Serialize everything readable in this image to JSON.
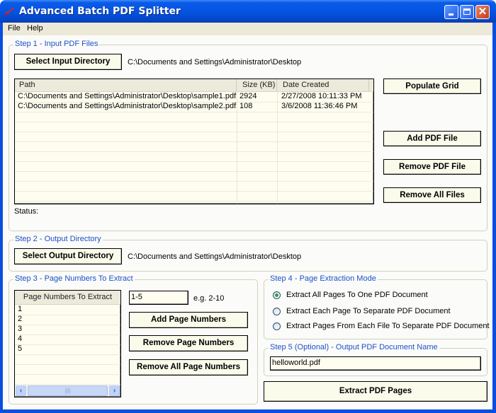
{
  "window": {
    "title": "Advanced Batch PDF Splitter",
    "icon": "scissors-pdf-icon",
    "controls": {
      "minimize": "minimize-icon",
      "maximize": "maximize-icon",
      "close": "close-icon",
      "close_glyph": "✕"
    }
  },
  "menu": {
    "items": [
      "File",
      "Help"
    ]
  },
  "step1": {
    "title": "Step 1 - Input PDF Files",
    "select_button": "Select Input Directory",
    "input_directory": "C:\\Documents and Settings\\Administrator\\Desktop",
    "grid": {
      "columns": [
        "Path",
        "Size (KB)",
        "Date Created"
      ],
      "rows": [
        [
          "C:\\Documents and Settings\\Administrator\\Desktop\\sample1.pdf",
          "2924",
          "2/27/2008 10:11:33 PM"
        ],
        [
          "C:\\Documents and Settings\\Administrator\\Desktop\\sample2.pdf",
          "108",
          "3/6/2008 11:36:46 PM"
        ]
      ]
    },
    "status_label": "Status:",
    "buttons": {
      "populate": "Populate Grid",
      "add": "Add PDF File",
      "remove": "Remove PDF File",
      "remove_all": "Remove All Files"
    }
  },
  "step2": {
    "title": "Step 2 - Output Directory",
    "select_button": "Select Output Directory",
    "output_directory": "C:\\Documents and Settings\\Administrator\\Desktop"
  },
  "step3": {
    "title": "Step 3 - Page Numbers To Extract",
    "list_header": "Page Numbers To Extract",
    "pages": [
      "1",
      "2",
      "3",
      "4",
      "5"
    ],
    "range_input": "1-5",
    "hint": "e.g. 2-10",
    "buttons": {
      "add": "Add Page Numbers",
      "remove": "Remove Page Numbers",
      "remove_all": "Remove All Page Numbers"
    },
    "scroll": {
      "left": "‹",
      "right": "›",
      "grip": "||||"
    }
  },
  "step4": {
    "title": "Step 4 - Page Extraction Mode",
    "options": [
      {
        "label": "Extract All Pages To One PDF Document",
        "selected": true
      },
      {
        "label": "Extract Each Page To Separate PDF Document",
        "selected": false
      },
      {
        "label": "Extract Pages From Each File To Separate PDF Document",
        "selected": false
      }
    ]
  },
  "step5": {
    "title": "Step 5 (Optional) - Output PDF Document Name",
    "filename": "helloworld.pdf"
  },
  "extract_button": "Extract PDF Pages"
}
